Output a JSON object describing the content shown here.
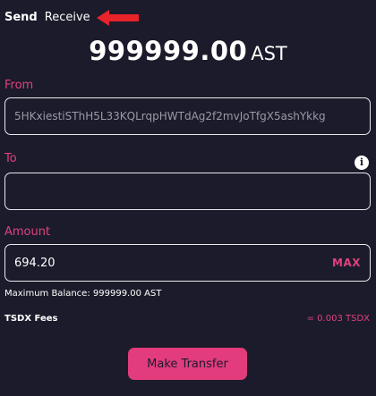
{
  "tabs": {
    "send": "Send",
    "receive": "Receive"
  },
  "balance": {
    "amount": "999999.00",
    "unit": "AST"
  },
  "from": {
    "label": "From",
    "value": "5HKxiestiSThH5L33KQLrqpHWTdAg2f2mvJoTfgX5ashYkkg"
  },
  "to": {
    "label": "To",
    "value": "",
    "info_icon": "info-icon"
  },
  "amount": {
    "label": "Amount",
    "value": "694.20",
    "max_label": "MAX"
  },
  "maximum_balance": "Maximum Balance: 999999.00 AST",
  "fees": {
    "label": "TSDX Fees",
    "value": "= 0.003 TSDX"
  },
  "submit_label": "Make Transfer",
  "colors": {
    "background": "#1c1b2b",
    "accent": "#e0417f",
    "arrow": "#e8232a"
  }
}
